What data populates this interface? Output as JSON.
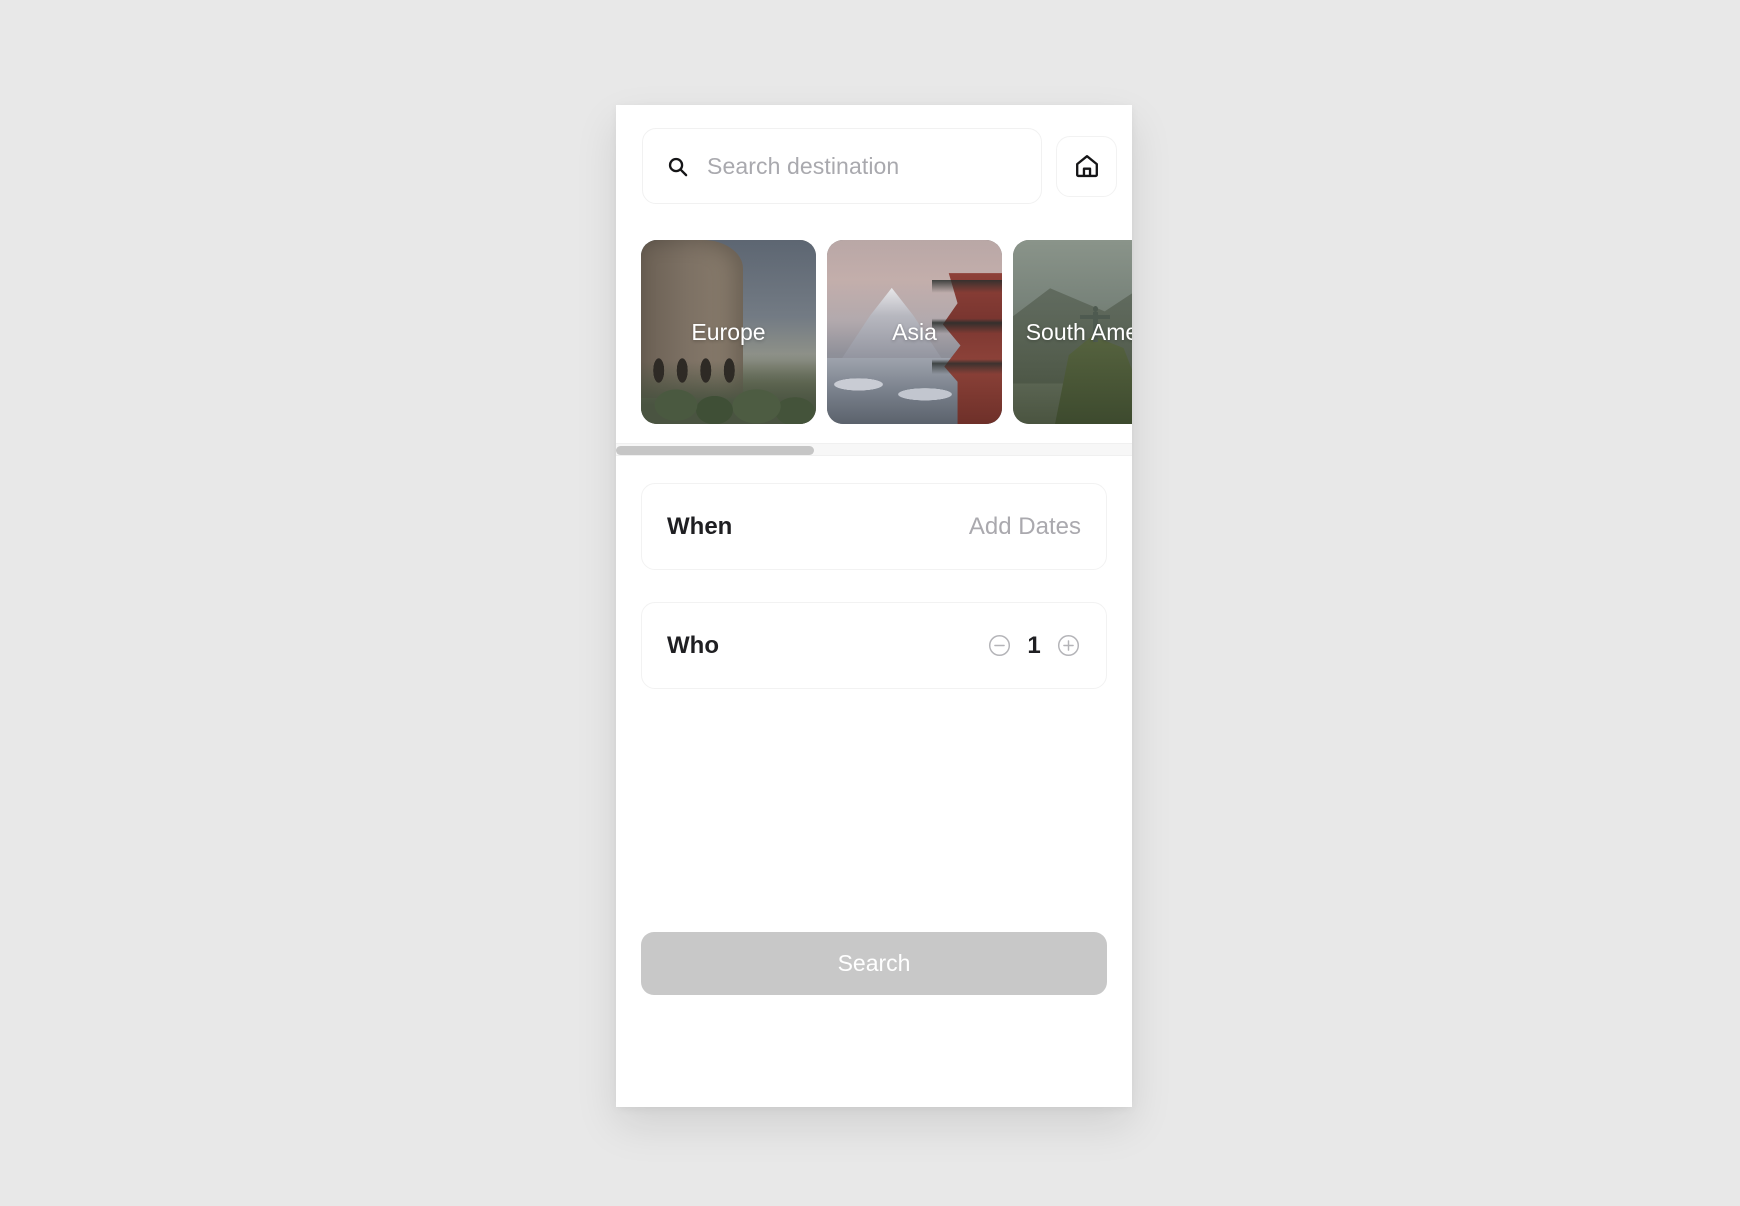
{
  "theme": {
    "page_background": "#e8e8e8",
    "panel_background": "#ffffff",
    "text_primary": "#1f1f22",
    "text_muted": "#aaa9ae",
    "button_disabled": "#c8c8c8",
    "scrollbar_thumb": "#c6c6c6"
  },
  "search": {
    "icon": "search-icon",
    "placeholder": "Search destination",
    "value": ""
  },
  "home_button": {
    "icon": "home-icon",
    "label": "Home"
  },
  "destinations": [
    {
      "label": "Europe",
      "icon": "colosseum-image"
    },
    {
      "label": "Asia",
      "icon": "mount-fuji-pagoda-image"
    },
    {
      "label": "South America",
      "icon": "christ-the-redeemer-image"
    }
  ],
  "options": {
    "when": {
      "label": "When",
      "value": "Add Dates"
    },
    "who": {
      "label": "Who",
      "count": "1",
      "decrement_icon": "minus-circle-icon",
      "increment_icon": "plus-circle-icon"
    }
  },
  "submit": {
    "label": "Search"
  }
}
